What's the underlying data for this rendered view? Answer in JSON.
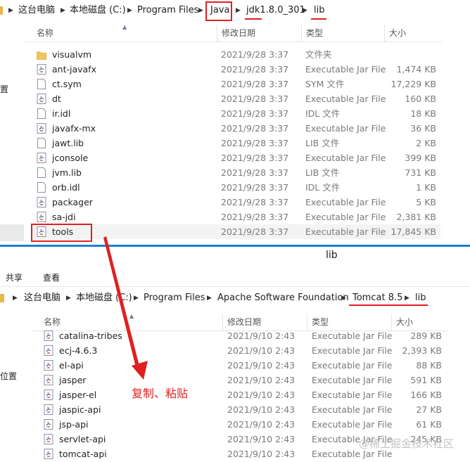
{
  "top": {
    "breadcrumbs": [
      "这台电脑",
      "本地磁盘 (C:)",
      "Program Files",
      "Java",
      "jdk1.8.0_301",
      "lib"
    ],
    "columns": [
      "名称",
      "修改日期",
      "类型",
      "大小"
    ],
    "sidebar_label": "置",
    "files": [
      {
        "name": "visualvm",
        "date": "2021/9/28 3:37",
        "type": "文件夹",
        "size": "",
        "icon": "folder-icon"
      },
      {
        "name": "ant-javafx",
        "date": "2021/9/28 3:37",
        "type": "Executable Jar File",
        "size": "1,474 KB",
        "icon": "jar-file-icon"
      },
      {
        "name": "ct.sym",
        "date": "2021/9/28 3:37",
        "type": "SYM 文件",
        "size": "17,229 KB",
        "icon": "file-icon"
      },
      {
        "name": "dt",
        "date": "2021/9/28 3:37",
        "type": "Executable Jar File",
        "size": "160 KB",
        "icon": "jar-file-icon"
      },
      {
        "name": "ir.idl",
        "date": "2021/9/28 3:37",
        "type": "IDL 文件",
        "size": "18 KB",
        "icon": "file-icon"
      },
      {
        "name": "javafx-mx",
        "date": "2021/9/28 3:37",
        "type": "Executable Jar File",
        "size": "36 KB",
        "icon": "jar-file-icon"
      },
      {
        "name": "jawt.lib",
        "date": "2021/9/28 3:37",
        "type": "LIB 文件",
        "size": "2 KB",
        "icon": "file-icon"
      },
      {
        "name": "jconsole",
        "date": "2021/9/28 3:37",
        "type": "Executable Jar File",
        "size": "399 KB",
        "icon": "jar-file-icon"
      },
      {
        "name": "jvm.lib",
        "date": "2021/9/28 3:37",
        "type": "LIB 文件",
        "size": "731 KB",
        "icon": "file-icon"
      },
      {
        "name": "orb.idl",
        "date": "2021/9/28 3:37",
        "type": "IDL 文件",
        "size": "1 KB",
        "icon": "file-icon"
      },
      {
        "name": "packager",
        "date": "2021/9/28 3:37",
        "type": "Executable Jar File",
        "size": "5 KB",
        "icon": "jar-file-icon"
      },
      {
        "name": "sa-jdi",
        "date": "2021/9/28 3:37",
        "type": "Executable Jar File",
        "size": "2,381 KB",
        "icon": "jar-file-icon"
      },
      {
        "name": "tools",
        "date": "2021/9/28 3:37",
        "type": "Executable Jar File",
        "size": "17,845 KB",
        "icon": "jar-file-icon"
      }
    ]
  },
  "bottom": {
    "window_title": "lib",
    "ribbon": [
      "共享",
      "查看"
    ],
    "breadcrumbs": [
      "这台电脑",
      "本地磁盘 (C:)",
      "Program Files",
      "Apache Software Foundation",
      "Tomcat 8.5",
      "lib"
    ],
    "columns": [
      "名称",
      "修改日期",
      "类型",
      "大小"
    ],
    "sidebar_label": "位置",
    "files": [
      {
        "name": "catalina-tribes",
        "date": "2021/9/10 2:43",
        "type": "Executable Jar File",
        "size": "289 KB",
        "icon": "jar-file-icon"
      },
      {
        "name": "ecj-4.6.3",
        "date": "2021/9/10 2:43",
        "type": "Executable Jar File",
        "size": "2,393 KB",
        "icon": "jar-file-icon"
      },
      {
        "name": "el-api",
        "date": "2021/9/10 2:43",
        "type": "Executable Jar File",
        "size": "88 KB",
        "icon": "jar-file-icon"
      },
      {
        "name": "jasper",
        "date": "2021/9/10 2:43",
        "type": "Executable Jar File",
        "size": "591 KB",
        "icon": "jar-file-icon"
      },
      {
        "name": "jasper-el",
        "date": "2021/9/10 2:43",
        "type": "Executable Jar File",
        "size": "166 KB",
        "icon": "jar-file-icon"
      },
      {
        "name": "jaspic-api",
        "date": "2021/9/10 2:43",
        "type": "Executable Jar File",
        "size": "27 KB",
        "icon": "jar-file-icon"
      },
      {
        "name": "jsp-api",
        "date": "2021/9/10 2:43",
        "type": "Executable Jar File",
        "size": "61 KB",
        "icon": "jar-file-icon"
      },
      {
        "name": "servlet-api",
        "date": "2021/9/10 2:43",
        "type": "Executable Jar File",
        "size": "245 KB",
        "icon": "jar-file-icon"
      },
      {
        "name": "tomcat-api",
        "date": "2021/9/10 2:43",
        "type": "Executable Jar File",
        "size": "",
        "icon": "jar-file-icon"
      }
    ]
  },
  "annotation": {
    "text": "复制、粘贴",
    "color": "#e02020"
  },
  "watermark": "@稀土掘金技术社区"
}
